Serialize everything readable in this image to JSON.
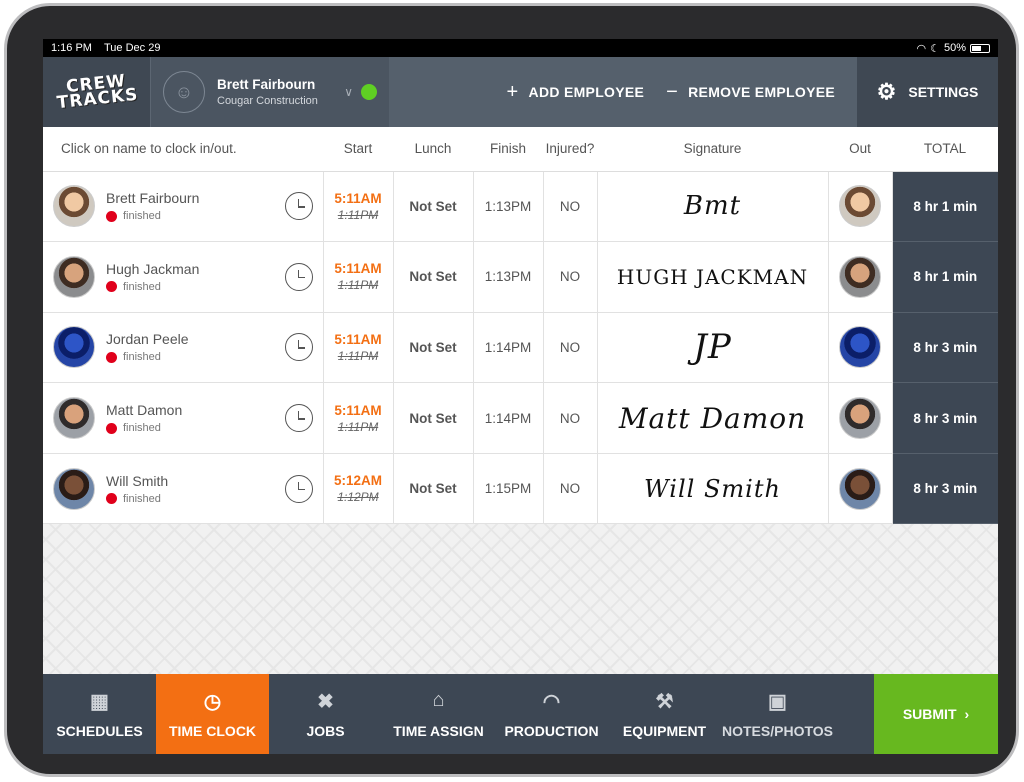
{
  "status": {
    "time": "1:16 PM",
    "date": "Tue Dec 29",
    "battery": "50%"
  },
  "logo": {
    "line1": "CREW",
    "line2": "TRACKS"
  },
  "user": {
    "name": "Brett Fairbourn",
    "company": "Cougar Construction",
    "online_color": "#5fcf23"
  },
  "header": {
    "add_label": "ADD EMPLOYEE",
    "remove_label": "REMOVE EMPLOYEE",
    "settings_label": "SETTINGS"
  },
  "table": {
    "headers": {
      "name": "Click on name to clock in/out.",
      "start": "Start",
      "lunch": "Lunch",
      "finish": "Finish",
      "injured": "Injured?",
      "signature": "Signature",
      "out": "Out",
      "total": "TOTAL"
    },
    "rows": [
      {
        "name": "Brett Fairbourn",
        "status": "finished",
        "start": "5:11AM",
        "start_old": "1:11PM",
        "lunch": "Not Set",
        "finish": "1:13PM",
        "injured": "NO",
        "signature": "Bmt",
        "total": "8 hr 1 min"
      },
      {
        "name": "Hugh Jackman",
        "status": "finished",
        "start": "5:11AM",
        "start_old": "1:11PM",
        "lunch": "Not Set",
        "finish": "1:13PM",
        "injured": "NO",
        "signature": "HUGH JACKMAN",
        "total": "8 hr 1 min"
      },
      {
        "name": "Jordan Peele",
        "status": "finished",
        "start": "5:11AM",
        "start_old": "1:11PM",
        "lunch": "Not Set",
        "finish": "1:14PM",
        "injured": "NO",
        "signature": "JP",
        "total": "8 hr 3 min"
      },
      {
        "name": "Matt Damon",
        "status": "finished",
        "start": "5:11AM",
        "start_old": "1:11PM",
        "lunch": "Not Set",
        "finish": "1:14PM",
        "injured": "NO",
        "signature": "Matt Damon",
        "total": "8 hr 3 min"
      },
      {
        "name": "Will Smith",
        "status": "finished",
        "start": "5:12AM",
        "start_old": "1:12PM",
        "lunch": "Not Set",
        "finish": "1:15PM",
        "injured": "NO",
        "signature": "Will Smith",
        "total": "8 hr 3 min"
      }
    ]
  },
  "bottom_nav": {
    "items": [
      "SCHEDULES",
      "TIME CLOCK",
      "JOBS",
      "TIME ASSIGN",
      "PRODUCTION",
      "EQUIPMENT",
      "NOTES/PHOTOS"
    ],
    "active": "TIME CLOCK",
    "submit_label": "SUBMIT"
  },
  "colors": {
    "accent": "#f36f13",
    "submit": "#67b81f",
    "header": "#4b5561",
    "status_finished": "#e0001b"
  }
}
